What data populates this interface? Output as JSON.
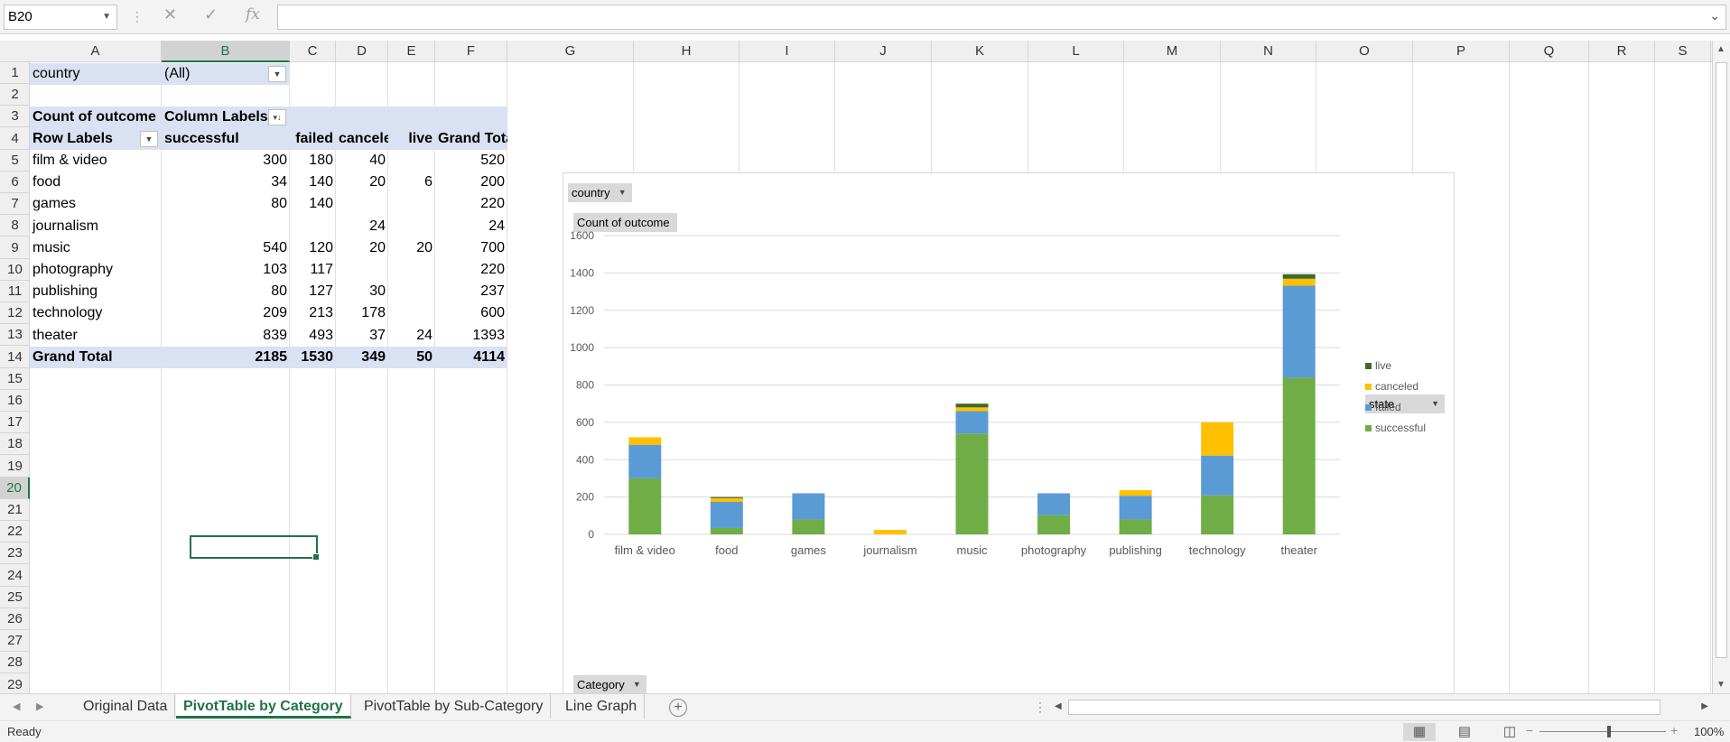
{
  "formula_bar": {
    "name_box": "B20",
    "formula": "",
    "cancel_icon": "✕",
    "enter_icon": "✓",
    "fx_icon": "fx"
  },
  "columns": [
    {
      "label": "A",
      "w": 146
    },
    {
      "label": "B",
      "w": 142
    },
    {
      "label": "C",
      "w": 51
    },
    {
      "label": "D",
      "w": 58
    },
    {
      "label": "E",
      "w": 52
    },
    {
      "label": "F",
      "w": 80
    },
    {
      "label": "G",
      "w": 140
    },
    {
      "label": "H",
      "w": 117
    },
    {
      "label": "I",
      "w": 106
    },
    {
      "label": "J",
      "w": 107
    },
    {
      "label": "K",
      "w": 107
    },
    {
      "label": "L",
      "w": 106
    },
    {
      "label": "M",
      "w": 107
    },
    {
      "label": "N",
      "w": 106
    },
    {
      "label": "O",
      "w": 107
    },
    {
      "label": "P",
      "w": 107
    },
    {
      "label": "Q",
      "w": 88
    },
    {
      "label": "R",
      "w": 73
    },
    {
      "label": "S",
      "w": 62
    }
  ],
  "selected_column": "B",
  "selected_row": 20,
  "rows": [
    "1",
    "2",
    "3",
    "4",
    "5",
    "6",
    "7",
    "8",
    "9",
    "10",
    "11",
    "12",
    "13",
    "14",
    "15",
    "16",
    "17",
    "18",
    "19",
    "20",
    "21",
    "22",
    "23",
    "24",
    "25",
    "26",
    "27",
    "28",
    "29"
  ],
  "pivot": {
    "filter_label": "country",
    "filter_value": "(All)",
    "values_label": "Count of outcome",
    "column_labels": "Column Labels",
    "row_labels": "Row Labels",
    "headers": [
      "successful",
      "failed",
      "canceled",
      "live",
      "Grand Total"
    ],
    "rows": [
      {
        "label": "film & video",
        "values": [
          "300",
          "180",
          "40",
          "",
          "520"
        ]
      },
      {
        "label": "food",
        "values": [
          "34",
          "140",
          "20",
          "6",
          "200"
        ]
      },
      {
        "label": "games",
        "values": [
          "80",
          "140",
          "",
          "",
          "220"
        ]
      },
      {
        "label": "journalism",
        "values": [
          "",
          "",
          "24",
          "",
          "24"
        ]
      },
      {
        "label": "music",
        "values": [
          "540",
          "120",
          "20",
          "20",
          "700"
        ]
      },
      {
        "label": "photography",
        "values": [
          "103",
          "117",
          "",
          "",
          "220"
        ]
      },
      {
        "label": "publishing",
        "values": [
          "80",
          "127",
          "30",
          "",
          "237"
        ]
      },
      {
        "label": "technology",
        "values": [
          "209",
          "213",
          "178",
          "",
          "600"
        ]
      },
      {
        "label": "theater",
        "values": [
          "839",
          "493",
          "37",
          "24",
          "1393"
        ]
      }
    ],
    "total": {
      "label": "Grand Total",
      "values": [
        "2185",
        "1530",
        "349",
        "50",
        "4114"
      ]
    }
  },
  "chart": {
    "filter_button": "country",
    "value_button": "Count of outcome",
    "axis_button": "Category",
    "legend_button": "state"
  },
  "chart_data": {
    "type": "bar",
    "stacked": true,
    "categories": [
      "film & video",
      "food",
      "games",
      "journalism",
      "music",
      "photography",
      "publishing",
      "technology",
      "theater"
    ],
    "series": [
      {
        "name": "successful",
        "color": "#70ad47",
        "values": [
          300,
          34,
          80,
          0,
          540,
          103,
          80,
          209,
          839
        ]
      },
      {
        "name": "failed",
        "color": "#5b9bd5",
        "values": [
          180,
          140,
          140,
          0,
          120,
          117,
          127,
          213,
          493
        ]
      },
      {
        "name": "canceled",
        "color": "#ffc000",
        "values": [
          40,
          20,
          0,
          24,
          20,
          0,
          30,
          178,
          37
        ]
      },
      {
        "name": "live",
        "color": "#43682b",
        "values": [
          0,
          6,
          0,
          0,
          20,
          0,
          0,
          0,
          24
        ]
      }
    ],
    "yticks": [
      "0",
      "200",
      "400",
      "600",
      "800",
      "1000",
      "1200",
      "1400",
      "1600"
    ],
    "ylim": [
      0,
      1600
    ],
    "grid": true,
    "legend_position": "right",
    "legend_order": [
      "live",
      "canceled",
      "failed",
      "successful"
    ]
  },
  "tabs": [
    "Original Data",
    "PivotTable by Category",
    "PivotTable by Sub-Category",
    "Line Graph"
  ],
  "active_tab": "PivotTable by Category",
  "status": {
    "text": "Ready",
    "zoom": "100%"
  },
  "colors": {
    "accent": "#217346",
    "pivot_header": "#d9e1f2"
  }
}
